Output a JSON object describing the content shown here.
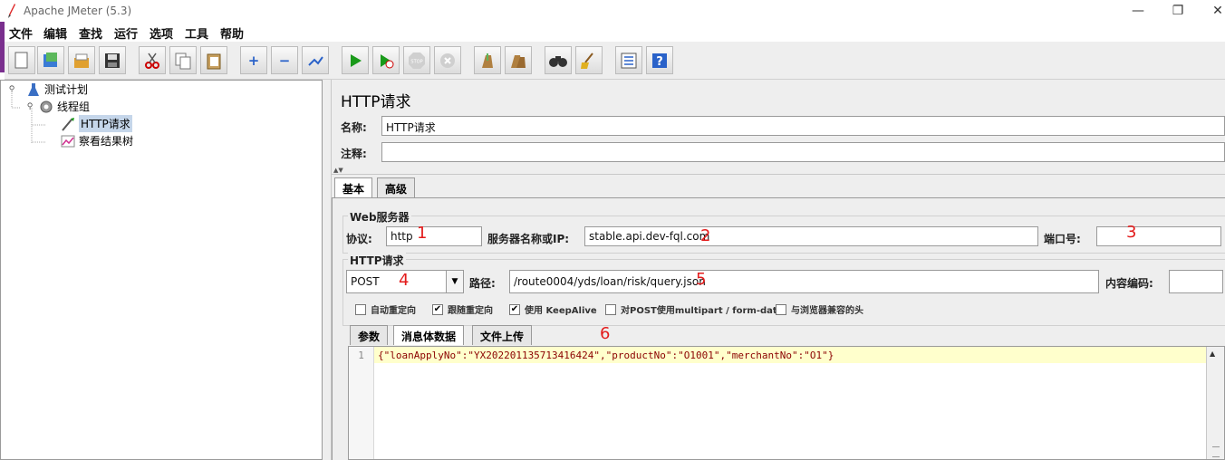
{
  "window": {
    "title": "Apache JMeter (5.3)",
    "minimize": "—",
    "maximize": "❐",
    "close": "✕"
  },
  "menu": [
    "文件",
    "编辑",
    "查找",
    "运行",
    "选项",
    "工具",
    "帮助"
  ],
  "toolbar": {
    "icons": [
      "new-icon",
      "templates-icon",
      "open-icon",
      "save-icon",
      "cut-icon",
      "copy-icon",
      "paste-icon",
      "expand-icon",
      "collapse-icon",
      "toggle-icon",
      "start-icon",
      "start-no-pause-icon",
      "stop-icon",
      "shutdown-icon",
      "clear-icon",
      "clear-all-icon",
      "search-icon",
      "reset-search-icon",
      "function-helper-icon",
      "help-icon"
    ]
  },
  "tree": {
    "items": [
      {
        "label": "测试计划",
        "icon": "test-plan-icon"
      },
      {
        "label": "线程组",
        "icon": "thread-group-icon"
      },
      {
        "label": "HTTP请求",
        "icon": "http-sampler-icon",
        "selected": true
      },
      {
        "label": "察看结果树",
        "icon": "results-tree-icon"
      }
    ]
  },
  "panel": {
    "title": "HTTP请求",
    "name_label": "名称:",
    "name_value": "HTTP请求",
    "comment_label": "注释:",
    "comment_value": "",
    "tabs": [
      "基本",
      "高级"
    ]
  },
  "web_server": {
    "group_title": "Web服务器",
    "protocol_label": "协议:",
    "protocol_value": "http",
    "server_label": "服务器名称或IP:",
    "server_value": "stable.api.dev-fql.com",
    "port_label": "端口号:",
    "port_value": ""
  },
  "http_request": {
    "group_title": "HTTP请求",
    "method": "POST",
    "path_label": "路径:",
    "path_value": "/route0004/yds/loan/risk/query.json",
    "encoding_label": "内容编码:",
    "encoding_value": ""
  },
  "checkboxes": [
    {
      "label": "自动重定向",
      "checked": false
    },
    {
      "label": "跟随重定向",
      "checked": true
    },
    {
      "label": "使用 KeepAlive",
      "checked": true
    },
    {
      "label": "对POST使用multipart / form-data",
      "checked": false
    },
    {
      "label": "与浏览器兼容的头",
      "checked": false
    }
  ],
  "body_tabs": [
    "参数",
    "消息体数据",
    "文件上传"
  ],
  "editor": {
    "line_number": "1",
    "code": "{\"loanApplyNo\":\"YX202201135713416424\",\"productNo\":\"O1001\",\"merchantNo\":\"O1\"}"
  },
  "annotations": [
    "1",
    "2",
    "3",
    "4",
    "5",
    "6"
  ],
  "colors": {
    "accent_purple": "#7a2f8e",
    "annotation_red": "#e31b1b",
    "selected_tree_bg": "#c5d6ea"
  }
}
